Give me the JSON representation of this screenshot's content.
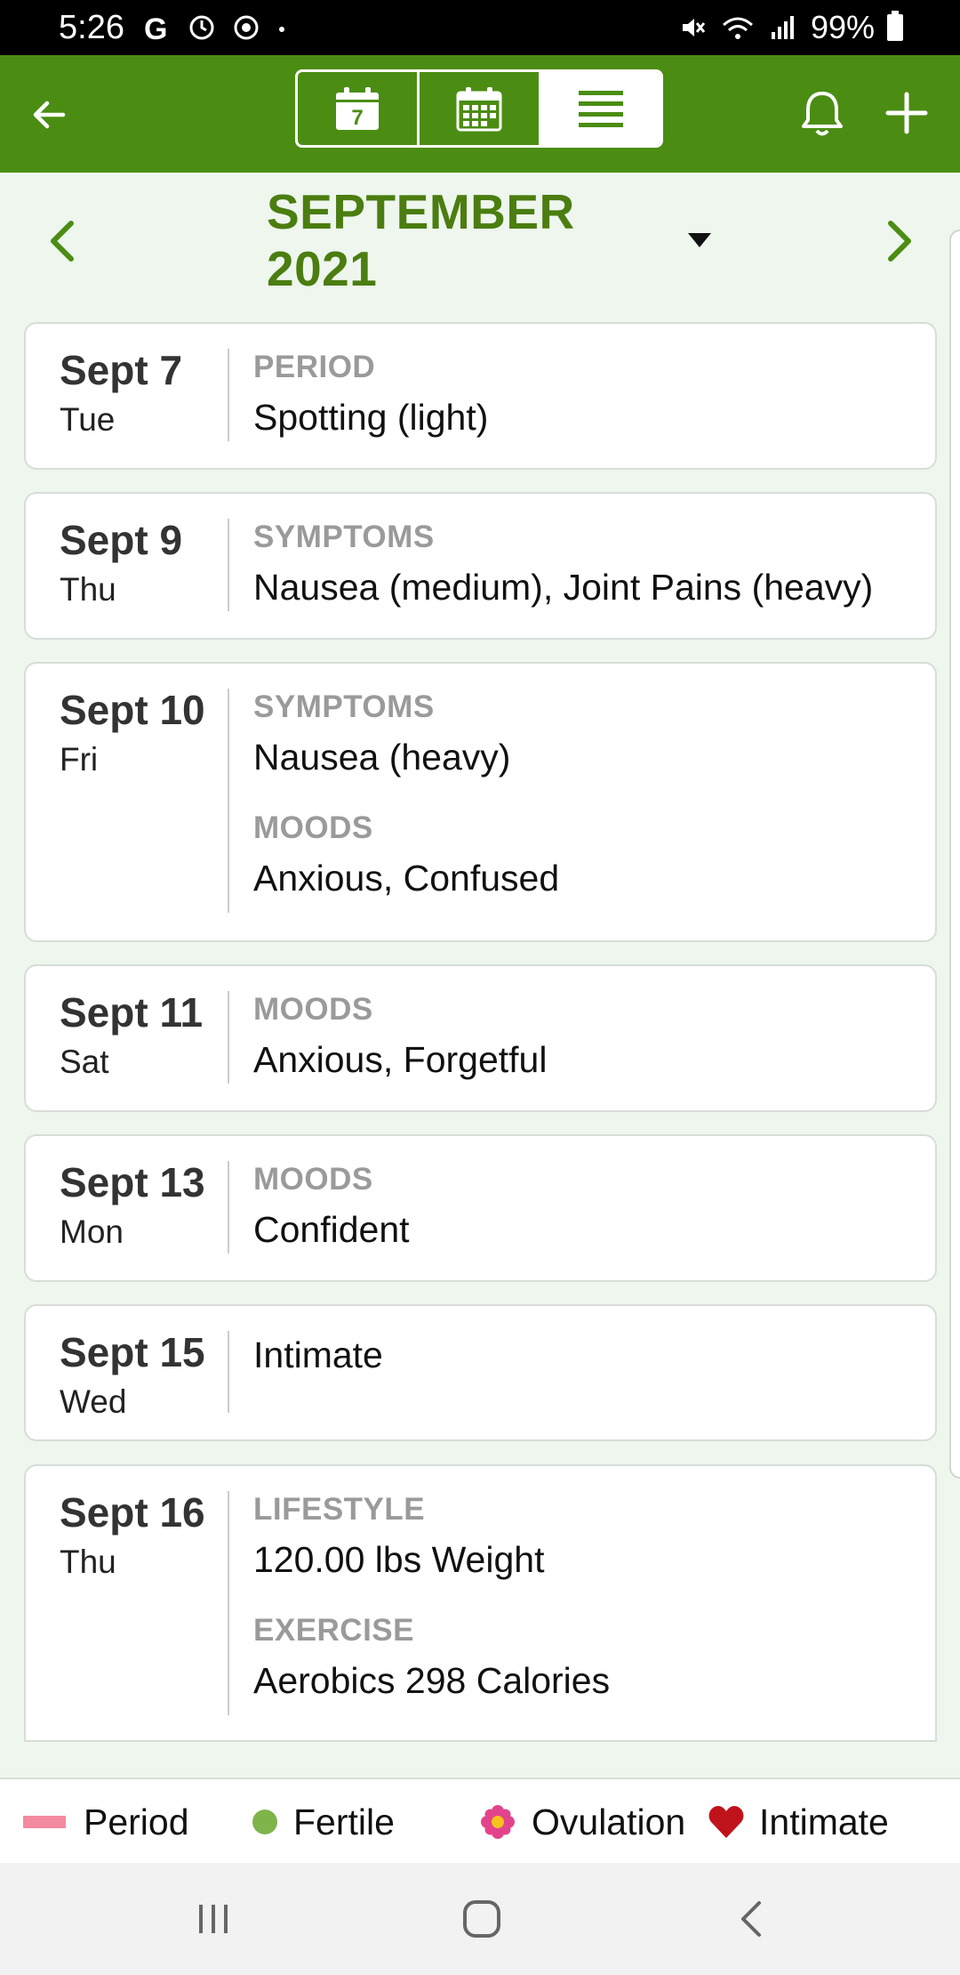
{
  "status_bar": {
    "time": "5:26",
    "battery": "99%"
  },
  "header": {
    "view_options": [
      "week-view",
      "month-view",
      "list-view"
    ],
    "active_view": "list-view"
  },
  "month_nav": {
    "title": "SEPTEMBER 2021"
  },
  "entries": [
    {
      "date": "Sept 7",
      "weekday": "Tue",
      "sections": [
        {
          "label": "PERIOD",
          "value": "Spotting (light)"
        }
      ]
    },
    {
      "date": "Sept 9",
      "weekday": "Thu",
      "sections": [
        {
          "label": "SYMPTOMS",
          "value": "Nausea (medium), Joint Pains (heavy)"
        }
      ]
    },
    {
      "date": "Sept 10",
      "weekday": "Fri",
      "sections": [
        {
          "label": "SYMPTOMS",
          "value": "Nausea (heavy)"
        },
        {
          "label": "MOODS",
          "value": "Anxious, Confused"
        }
      ]
    },
    {
      "date": "Sept 11",
      "weekday": "Sat",
      "sections": [
        {
          "label": "MOODS",
          "value": "Anxious, Forgetful"
        }
      ]
    },
    {
      "date": "Sept 13",
      "weekday": "Mon",
      "sections": [
        {
          "label": "MOODS",
          "value": "Confident"
        }
      ]
    },
    {
      "date": "Sept 15",
      "weekday": "Wed",
      "sections": [
        {
          "label": "",
          "value": "Intimate"
        }
      ]
    },
    {
      "date": "Sept 16",
      "weekday": "Thu",
      "sections": [
        {
          "label": "LIFESTYLE",
          "value": "120.00 lbs Weight"
        },
        {
          "label": "EXERCISE",
          "value": "Aerobics 298 Calories"
        }
      ]
    }
  ],
  "legend": {
    "period": "Period",
    "fertile": "Fertile",
    "ovulation": "Ovulation",
    "intimate": "Intimate"
  },
  "colors": {
    "brand_green": "#4b8d13",
    "title_green": "#4b7d10",
    "period_pink": "#f48a9f",
    "fertile_green": "#7fb44a",
    "ovulation_pink": "#e2448c",
    "intimate_red": "#c0121b"
  }
}
